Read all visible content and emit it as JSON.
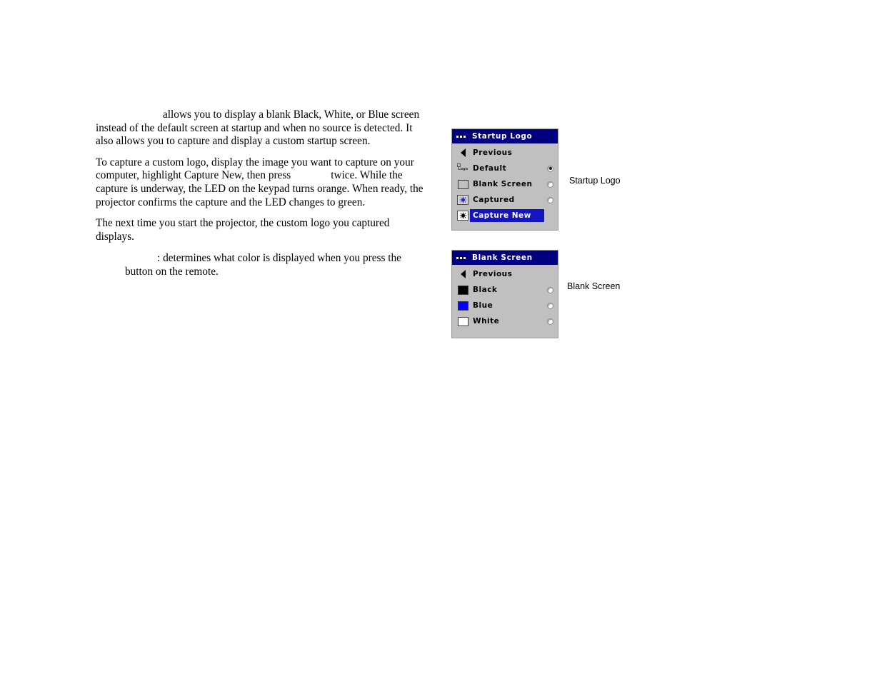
{
  "document": {
    "paragraphs": [
      {
        "id": "p1",
        "lead_gap": true,
        "text": "allows you to display a blank Black, White, or Blue screen instead of the default screen at startup and when no source is detected. It also allows you to capture and display a custom startup screen."
      },
      {
        "id": "p2",
        "text_before_gap": "To capture a custom logo, display the image you want to capture on your computer, highlight Capture New, then press",
        "text_after_gap": "twice. While the capture is underway, the LED on the keypad turns orange. When ready, the projector confirms the capture and the LED changes to green."
      },
      {
        "id": "p3",
        "text": "The next time you start the projector, the custom logo you captured displays."
      },
      {
        "id": "p4",
        "text": ": determines what color is displayed when you press the button on the remote."
      }
    ]
  },
  "menus": [
    {
      "id": "startup-logo",
      "title": "Startup Logo",
      "title_icon": "menu-dots-icon",
      "caption": "Startup Logo",
      "rows": [
        {
          "label": "Previous",
          "icon": "back-triangle-icon",
          "radio": null,
          "selected": false
        },
        {
          "label": "Default",
          "icon": "default-logo-icon",
          "radio": "on",
          "selected": false
        },
        {
          "label": "Blank Screen",
          "icon": "blank-screen-icon",
          "radio": "off",
          "selected": false
        },
        {
          "label": "Captured",
          "icon": "captured-burst-icon",
          "radio": "off",
          "selected": false
        },
        {
          "label": "Capture New",
          "icon": "capture-new-icon",
          "radio": null,
          "selected": true
        }
      ]
    },
    {
      "id": "blank-screen",
      "title": "Blank Screen",
      "title_icon": "menu-dots-icon",
      "caption": "Blank Screen",
      "rows": [
        {
          "label": "Previous",
          "icon": "back-triangle-icon",
          "radio": null,
          "selected": false
        },
        {
          "label": "Black",
          "icon": "swatch-black-icon",
          "radio": "off",
          "selected": false
        },
        {
          "label": "Blue",
          "icon": "swatch-blue-icon",
          "radio": "off",
          "selected": false
        },
        {
          "label": "White",
          "icon": "swatch-white-icon",
          "radio": "off",
          "selected": false
        }
      ]
    }
  ],
  "colors": {
    "menu_background": "#c0c0c0",
    "titlebar": "#000080",
    "highlight": "#1515c0",
    "swatch_black": "#000000",
    "swatch_blue": "#0000ff",
    "swatch_white": "#ffffff"
  }
}
